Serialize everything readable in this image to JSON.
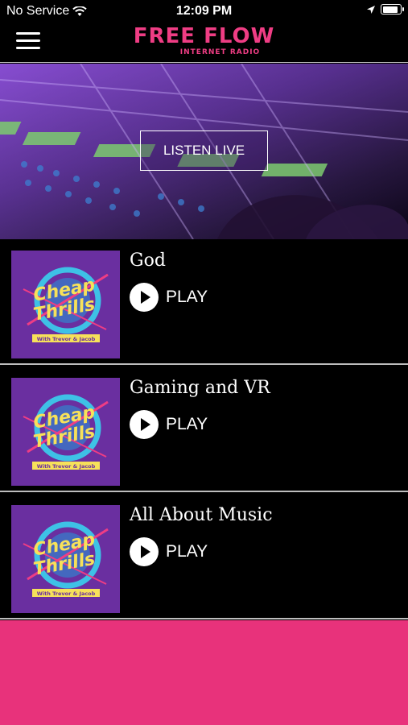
{
  "status": {
    "carrier": "No Service",
    "time": "12:09 PM",
    "battery_level": 0.9
  },
  "nav": {
    "logo_title": "FREE FLOW",
    "logo_subtitle": "INTERNET RADIO"
  },
  "hero": {
    "listen_label": "LISTEN LIVE"
  },
  "episodes": [
    {
      "title": "God",
      "play_label": "PLAY",
      "thumb_title_line1": "Cheap",
      "thumb_title_line2": "Thrills",
      "thumb_caption": "With Trevor & Jacob"
    },
    {
      "title": "Gaming and VR",
      "play_label": "PLAY",
      "thumb_title_line1": "Cheap",
      "thumb_title_line2": "Thrills",
      "thumb_caption": "With Trevor & Jacob"
    },
    {
      "title": "All About Music",
      "play_label": "PLAY",
      "thumb_title_line1": "Cheap",
      "thumb_title_line2": "Thrills",
      "thumb_caption": "With Trevor & Jacob"
    }
  ],
  "colors": {
    "accent": "#ef3d84",
    "footer": "#e8327b",
    "thumb_bg": "#6a2fa0"
  }
}
